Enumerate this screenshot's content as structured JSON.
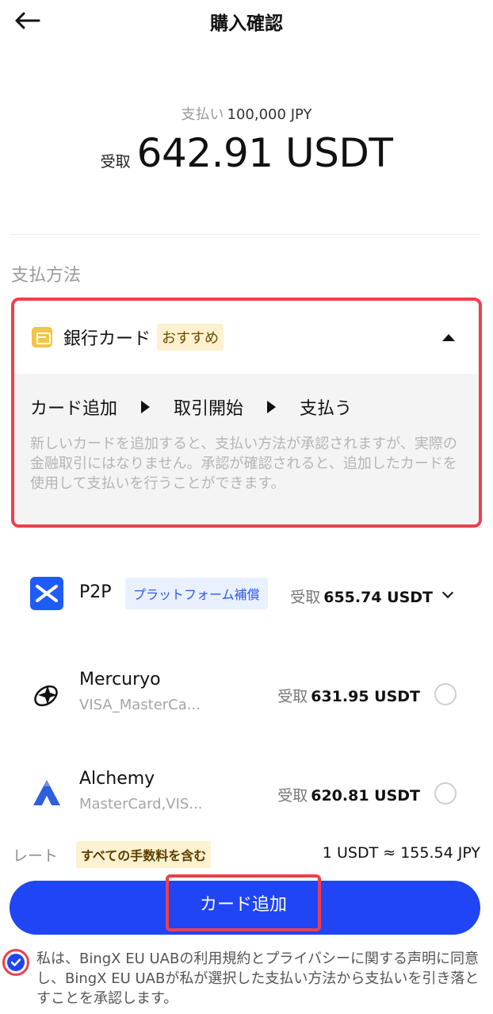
{
  "header": {
    "title": "購入確認",
    "back_icon": "arrow-left-icon"
  },
  "summary": {
    "pay_label": "支払い",
    "pay_amount": "100,000 JPY",
    "receive_label": "受取",
    "receive_amount": "642.91 USDT"
  },
  "payment_section": {
    "label": "支払方法"
  },
  "bank_card": {
    "title": "銀行カード",
    "badge": "おすすめ",
    "steps": [
      "カード追加",
      "取引開始",
      "支払う"
    ],
    "description": "新しいカードを追加すると、支払い方法が承認されますが、実際の金融取引にはなりません。承認が確認されると、追加したカードを使用して支払いを行うことができます。"
  },
  "methods": [
    {
      "name": "P2P",
      "badge": "プラットフォーム補償",
      "receive_label": "受取",
      "receive_amount": "655.74 USDT"
    },
    {
      "name": "Mercuryo",
      "sub": "VISA_MasterCa...",
      "receive_label": "受取",
      "receive_amount": "631.95 USDT"
    },
    {
      "name": "Alchemy",
      "sub": "MasterCard,VIS...",
      "receive_label": "受取",
      "receive_amount": "620.81 USDT"
    }
  ],
  "rate": {
    "label": "レート",
    "fee_badge": "すべての手数料を含む",
    "value": "1 USDT ≈ 155.54 JPY"
  },
  "cta": {
    "label": "カード追加"
  },
  "agreement": {
    "checked": true,
    "text": "私は、BingX EU UABの利用規約とプライバシーに関する声明に同意し、BingX EU UABが私が選択した支払い方法から支払いを引き落とすことを承認します。"
  },
  "colors": {
    "primary": "#1f45f5",
    "highlight": "#ef3f4b",
    "badge_bg": "#fdf1cf"
  }
}
